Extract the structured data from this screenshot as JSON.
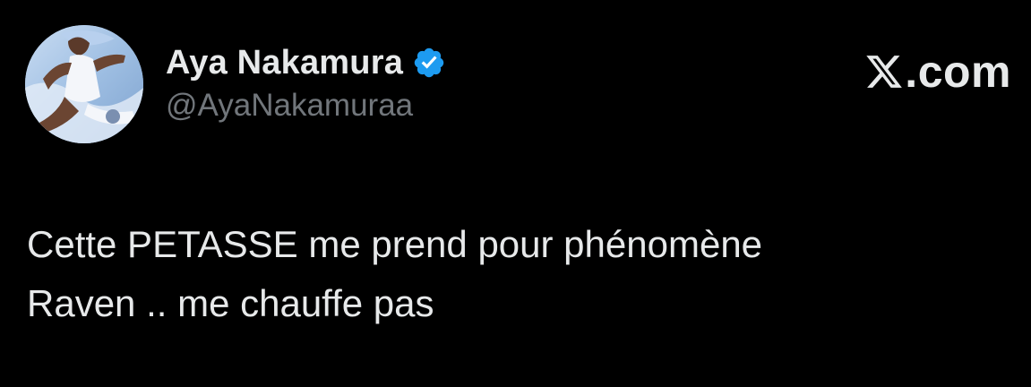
{
  "tweet": {
    "author": {
      "display_name": "Aya Nakamura",
      "handle": "@AyaNakamuraa",
      "verified": true,
      "verified_color": "#1d9bf0",
      "avatar_icon": "profile-photo"
    },
    "brand": {
      "icon": "x-logo-icon",
      "text": ".com"
    },
    "text_lines": [
      "Cette PETASSE me prend pour phénomène",
      "Raven .. me chauffe pas"
    ]
  },
  "colors": {
    "background": "#000000",
    "primary_text": "#e7e9ea",
    "secondary_text": "#71767b"
  }
}
